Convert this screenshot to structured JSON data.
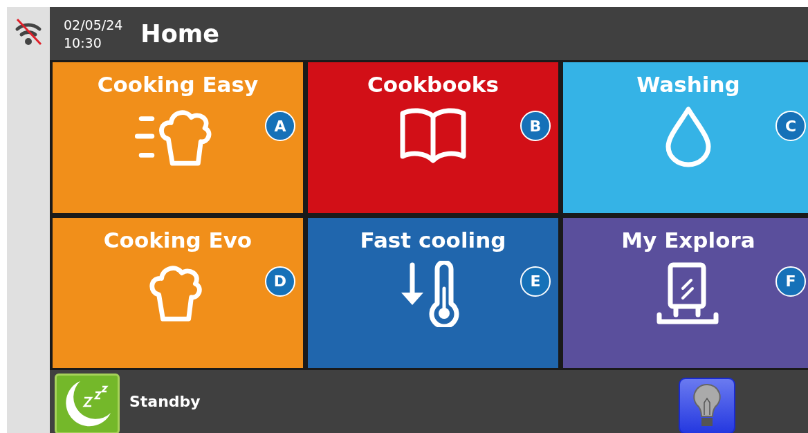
{
  "header": {
    "date": "02/05/24",
    "time": "10:30",
    "title": "Home"
  },
  "tiles": [
    {
      "label": "Cooking Easy",
      "badge": "A",
      "color": "#f18f1a",
      "kind": "fast-hat"
    },
    {
      "label": "Cookbooks",
      "badge": "B",
      "color": "#d20f17",
      "kind": "book"
    },
    {
      "label": "Washing",
      "badge": "C",
      "color": "#35b3e6",
      "kind": "drop"
    },
    {
      "label": "Cooking Evo",
      "badge": "D",
      "color": "#f18f1a",
      "kind": "hat"
    },
    {
      "label": "Fast cooling",
      "badge": "E",
      "color": "#2066ad",
      "kind": "cooling"
    },
    {
      "label": "My Explora",
      "badge": "F",
      "color": "#5a4f9c",
      "kind": "oven"
    }
  ],
  "footer": {
    "standby": "Standby"
  }
}
